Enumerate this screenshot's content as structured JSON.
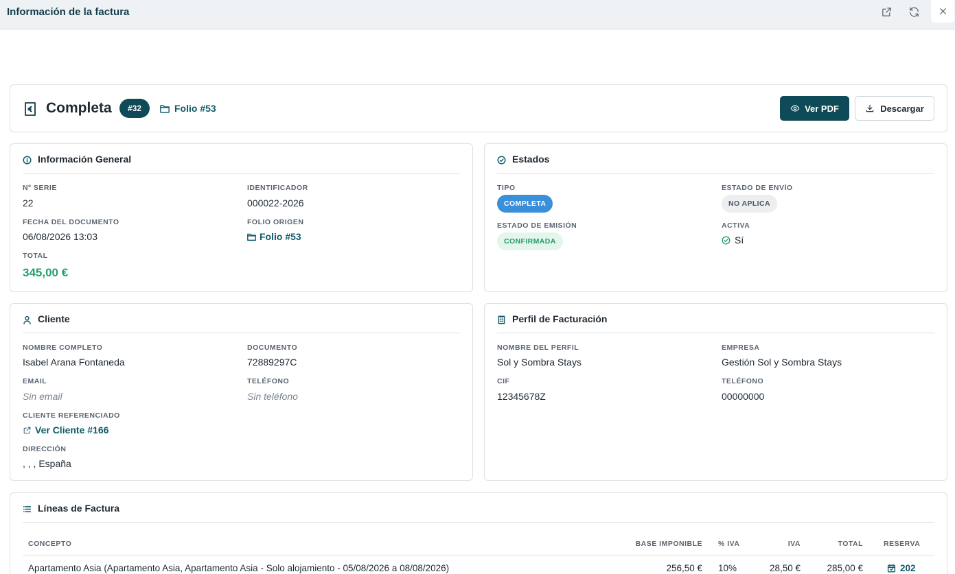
{
  "window": {
    "title": "Información de la factura"
  },
  "header": {
    "title": "Completa",
    "number_badge": "#32",
    "folio_link": "Folio #53",
    "view_pdf_label": "Ver PDF",
    "download_label": "Descargar"
  },
  "general": {
    "title": "Información General",
    "serie_label": "Nº SERIE",
    "serie_value": "22",
    "id_label": "IDENTIFICADOR",
    "id_value": "000022-2026",
    "date_label": "FECHA DEL DOCUMENTO",
    "date_value": "06/08/2026 13:03",
    "folio_label": "FOLIO ORIGEN",
    "folio_value": "Folio #53",
    "total_label": "TOTAL",
    "total_value": "345,00 €"
  },
  "estados": {
    "title": "Estados",
    "tipo_label": "TIPO",
    "tipo_value": "COMPLETA",
    "envio_label": "ESTADO DE ENVÍO",
    "envio_value": "NO APLICA",
    "emision_label": "ESTADO DE EMISIÓN",
    "emision_value": "CONFIRMADA",
    "activa_label": "ACTIVA",
    "activa_value": "Sí"
  },
  "cliente": {
    "title": "Cliente",
    "nombre_label": "NOMBRE COMPLETO",
    "nombre_value": "Isabel Arana Fontaneda",
    "documento_label": "DOCUMENTO",
    "documento_value": "72889297C",
    "email_label": "EMAIL",
    "email_value": "Sin email",
    "telefono_label": "TELÉFONO",
    "telefono_value": "Sin teléfono",
    "ref_label": "CLIENTE REFERENCIADO",
    "ref_value": "Ver Cliente #166",
    "direccion_label": "DIRECCIÓN",
    "direccion_value": ", , , España"
  },
  "perfil": {
    "title": "Perfil de Facturación",
    "nombre_label": "NOMBRE DEL PERFIL",
    "nombre_value": "Sol y Sombra Stays",
    "empresa_label": "EMPRESA",
    "empresa_value": "Gestión Sol y Sombra Stays",
    "cif_label": "CIF",
    "cif_value": "12345678Z",
    "telefono_label": "TELÉFONO",
    "telefono_value": "00000000"
  },
  "lineas": {
    "title": "Líneas de Factura",
    "columns": [
      "CONCEPTO",
      "BASE IMPONIBLE",
      "% IVA",
      "IVA",
      "TOTAL",
      "RESERVA"
    ],
    "rows": [
      {
        "concepto": "Apartamento Asia (Apartamento Asia, Apartamento Asia - Solo alojamiento - 05/08/2026 a 08/08/2026)",
        "base": "256,50 €",
        "pct_iva": "10%",
        "iva": "28,50 €",
        "total": "285,00 €",
        "reserva": "202"
      }
    ]
  },
  "icons": {
    "open_external": "external-link-icon",
    "refresh": "refresh-icon",
    "close": "close-icon",
    "invoice": "euro-receipt-icon"
  },
  "colors": {
    "primary": "#0e4a57",
    "link": "#0f5a68",
    "success": "#22a06b",
    "badge_blue": "#3a8fd9"
  }
}
